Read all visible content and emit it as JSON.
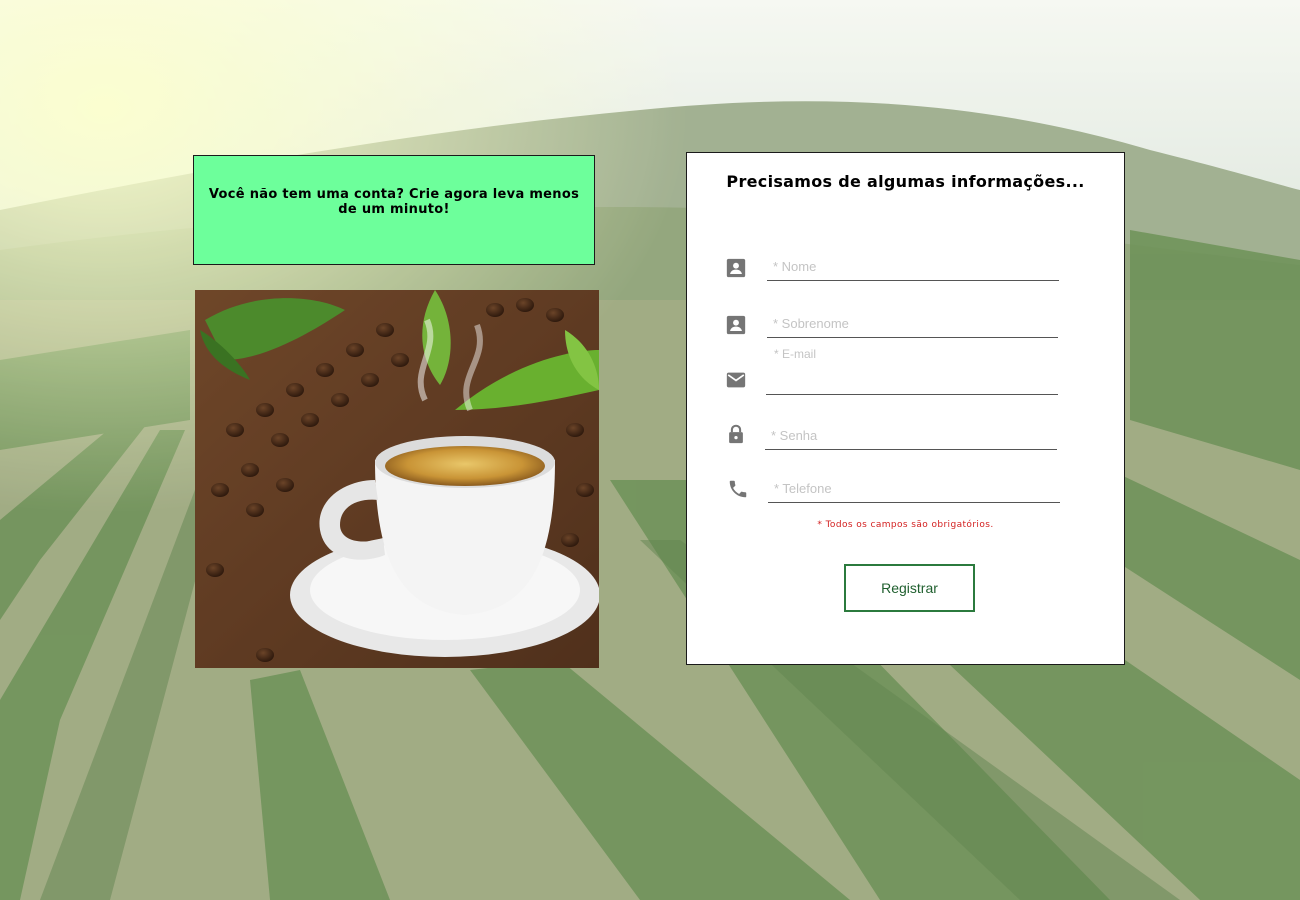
{
  "promo": {
    "text": "Você não tem uma conta? Crie agora leva menos de um minuto!"
  },
  "form": {
    "title": "Precisamos de algumas informações...",
    "fields": {
      "nome": {
        "placeholder": "* Nome",
        "icon": "person-card-icon"
      },
      "sobrenome": {
        "placeholder": "* Sobrenome",
        "icon": "person-card-icon"
      },
      "email": {
        "label": "* E-mail",
        "icon": "email-icon"
      },
      "senha": {
        "placeholder": "* Senha",
        "icon": "lock-icon"
      },
      "telefone": {
        "placeholder": "* Telefone",
        "icon": "phone-icon"
      }
    },
    "required_note": "* Todos os campos são obrigatórios.",
    "submit_label": "Registrar"
  },
  "colors": {
    "promo_bg": "#6dff9b",
    "accent_green": "#2b7a3d",
    "note_red": "#d32020",
    "icon_gray": "#757575"
  }
}
